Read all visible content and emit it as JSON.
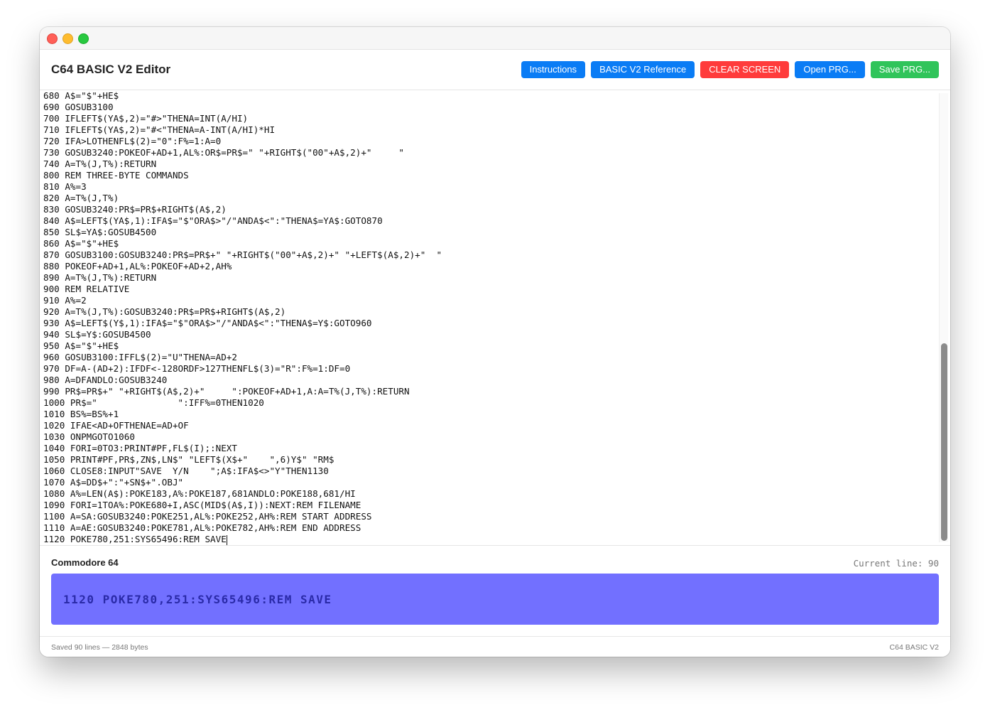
{
  "window": {
    "title": "C64 BASIC V2 Editor"
  },
  "toolbar": {
    "buttons": [
      {
        "label": "Instructions",
        "color": "#0a7cf5"
      },
      {
        "label": "BASIC V2 Reference",
        "color": "#0a7cf5"
      },
      {
        "label": "CLEAR SCREEN",
        "color": "#ff3b3b"
      },
      {
        "label": "Open PRG...",
        "color": "#0a7cf5"
      },
      {
        "label": "Save PRG...",
        "color": "#30c45a"
      }
    ]
  },
  "editor": {
    "lines": [
      "680 A$=\"$\"+HE$",
      "690 GOSUB3100",
      "700 IFLEFT$(YA$,2)=\"#>\"THENA=INT(A/HI)",
      "710 IFLEFT$(YA$,2)=\"#<\"THENA=A-INT(A/HI)*HI",
      "720 IFA>LOTHENFL$(2)=\"0\":F%=1:A=0",
      "730 GOSUB3240:POKEOF+AD+1,AL%:OR$=PR$=\" \"+RIGHT$(\"00\"+A$,2)+\"     \"",
      "740 A=T%(J,T%):RETURN",
      "800 REM THREE-BYTE COMMANDS",
      "810 A%=3",
      "820 A=T%(J,T%)",
      "830 GOSUB3240:PR$=PR$+RIGHT$(A$,2)",
      "840 A$=LEFT$(YA$,1):IFA$=\"$\"ORA$>\"/\"ANDA$<\":\"THENA$=YA$:GOTO870",
      "850 SL$=YA$:GOSUB4500",
      "860 A$=\"$\"+HE$",
      "870 GOSUB3100:GOSUB3240:PR$=PR$+\" \"+RIGHT$(\"00\"+A$,2)+\" \"+LEFT$(A$,2)+\"  \"",
      "880 POKEOF+AD+1,AL%:POKEOF+AD+2,AH%",
      "890 A=T%(J,T%):RETURN",
      "900 REM RELATIVE",
      "910 A%=2",
      "920 A=T%(J,T%):GOSUB3240:PR$=PR$+RIGHT$(A$,2)",
      "930 A$=LEFT$(Y$,1):IFA$=\"$\"ORA$>\"/\"ANDA$<\":\"THENA$=Y$:GOTO960",
      "940 SL$=Y$:GOSUB4500",
      "950 A$=\"$\"+HE$",
      "960 GOSUB3100:IFFL$(2)=\"U\"THENA=AD+2",
      "970 DF=A-(AD+2):IFDF<-128ORDF>127THENFL$(3)=\"R\":F%=1:DF=0",
      "980 A=DFANDLO:GOSUB3240",
      "990 PR$=PR$+\" \"+RIGHT$(A$,2)+\"     \":POKEOF+AD+1,A:A=T%(J,T%):RETURN",
      "1000 PR$=\"               \":IFF%=0THEN1020",
      "1010 BS%=BS%+1",
      "1020 IFAE<AD+OFTHENAE=AD+OF",
      "1030 ONPMGOTO1060",
      "1040 FORI=0TO3:PRINT#PF,FL$(I);:NEXT",
      "1050 PRINT#PF,PR$,ZN$,LN$\" \"LEFT$(X$+\"    \",6)Y$\" \"RM$",
      "1060 CLOSE8:INPUT\"SAVE  Y/N    \";A$:IFA$<>\"Y\"THEN1130",
      "1070 A$=DD$+\":\"+SN$+\".OBJ\"",
      "1080 A%=LEN(A$):POKE183,A%:POKE187,681ANDLO:POKE188,681/HI",
      "1090 FORI=1TOA%:POKE680+I,ASC(MID$(A$,I)):NEXT:REM FILENAME",
      "1100 A=SA:GOSUB3240:POKE251,AL%:POKE252,AH%:REM START ADDRESS",
      "1110 A=AE:GOSUB3240:POKE781,AL%:POKE782,AH%:REM END ADDRESS",
      "1120 POKE780,251:SYS65496:REM SAVE"
    ]
  },
  "c64": {
    "title": "Commodore 64",
    "current_line": "Current line: 90",
    "screen_text": "1120 POKE780,251:SYS65496:REM SAVE",
    "screen_bg": "#7270ff",
    "screen_fg": "#2a2aa8"
  },
  "status": {
    "left": "Saved 90 lines — 2848 bytes",
    "right": "C64 BASIC V2"
  }
}
